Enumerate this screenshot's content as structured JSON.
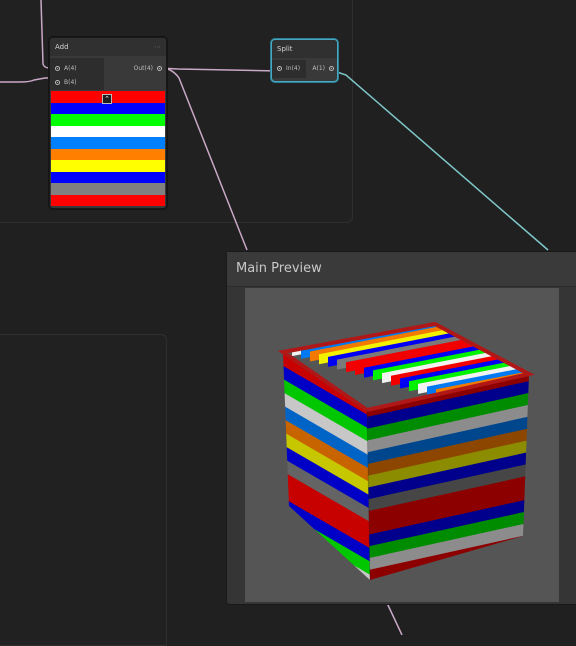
{
  "nodes": {
    "add": {
      "title": "Add",
      "collapse_glyph": "⋯",
      "inputs": [
        {
          "label": "A(4)"
        },
        {
          "label": "B(4)"
        }
      ],
      "output": {
        "label": "Out(4)"
      },
      "preview_collapse_glyph": "⌃"
    },
    "split": {
      "title": "Split",
      "input": {
        "label": "In(4)"
      },
      "output": {
        "label": "A(1)"
      }
    }
  },
  "stripes": [
    "#ff0000",
    "#0000ff",
    "#00ff00",
    "#ffffff",
    "#0080ff",
    "#ff8000",
    "#ffff00",
    "#0000ff",
    "#808080",
    "#ff0000"
  ],
  "main_preview": {
    "title": "Main Preview"
  },
  "colors": {
    "wire_vector4": "#c9a8c6",
    "wire_float": "#7fc7c9",
    "selection_accent": "#44a8c4"
  }
}
